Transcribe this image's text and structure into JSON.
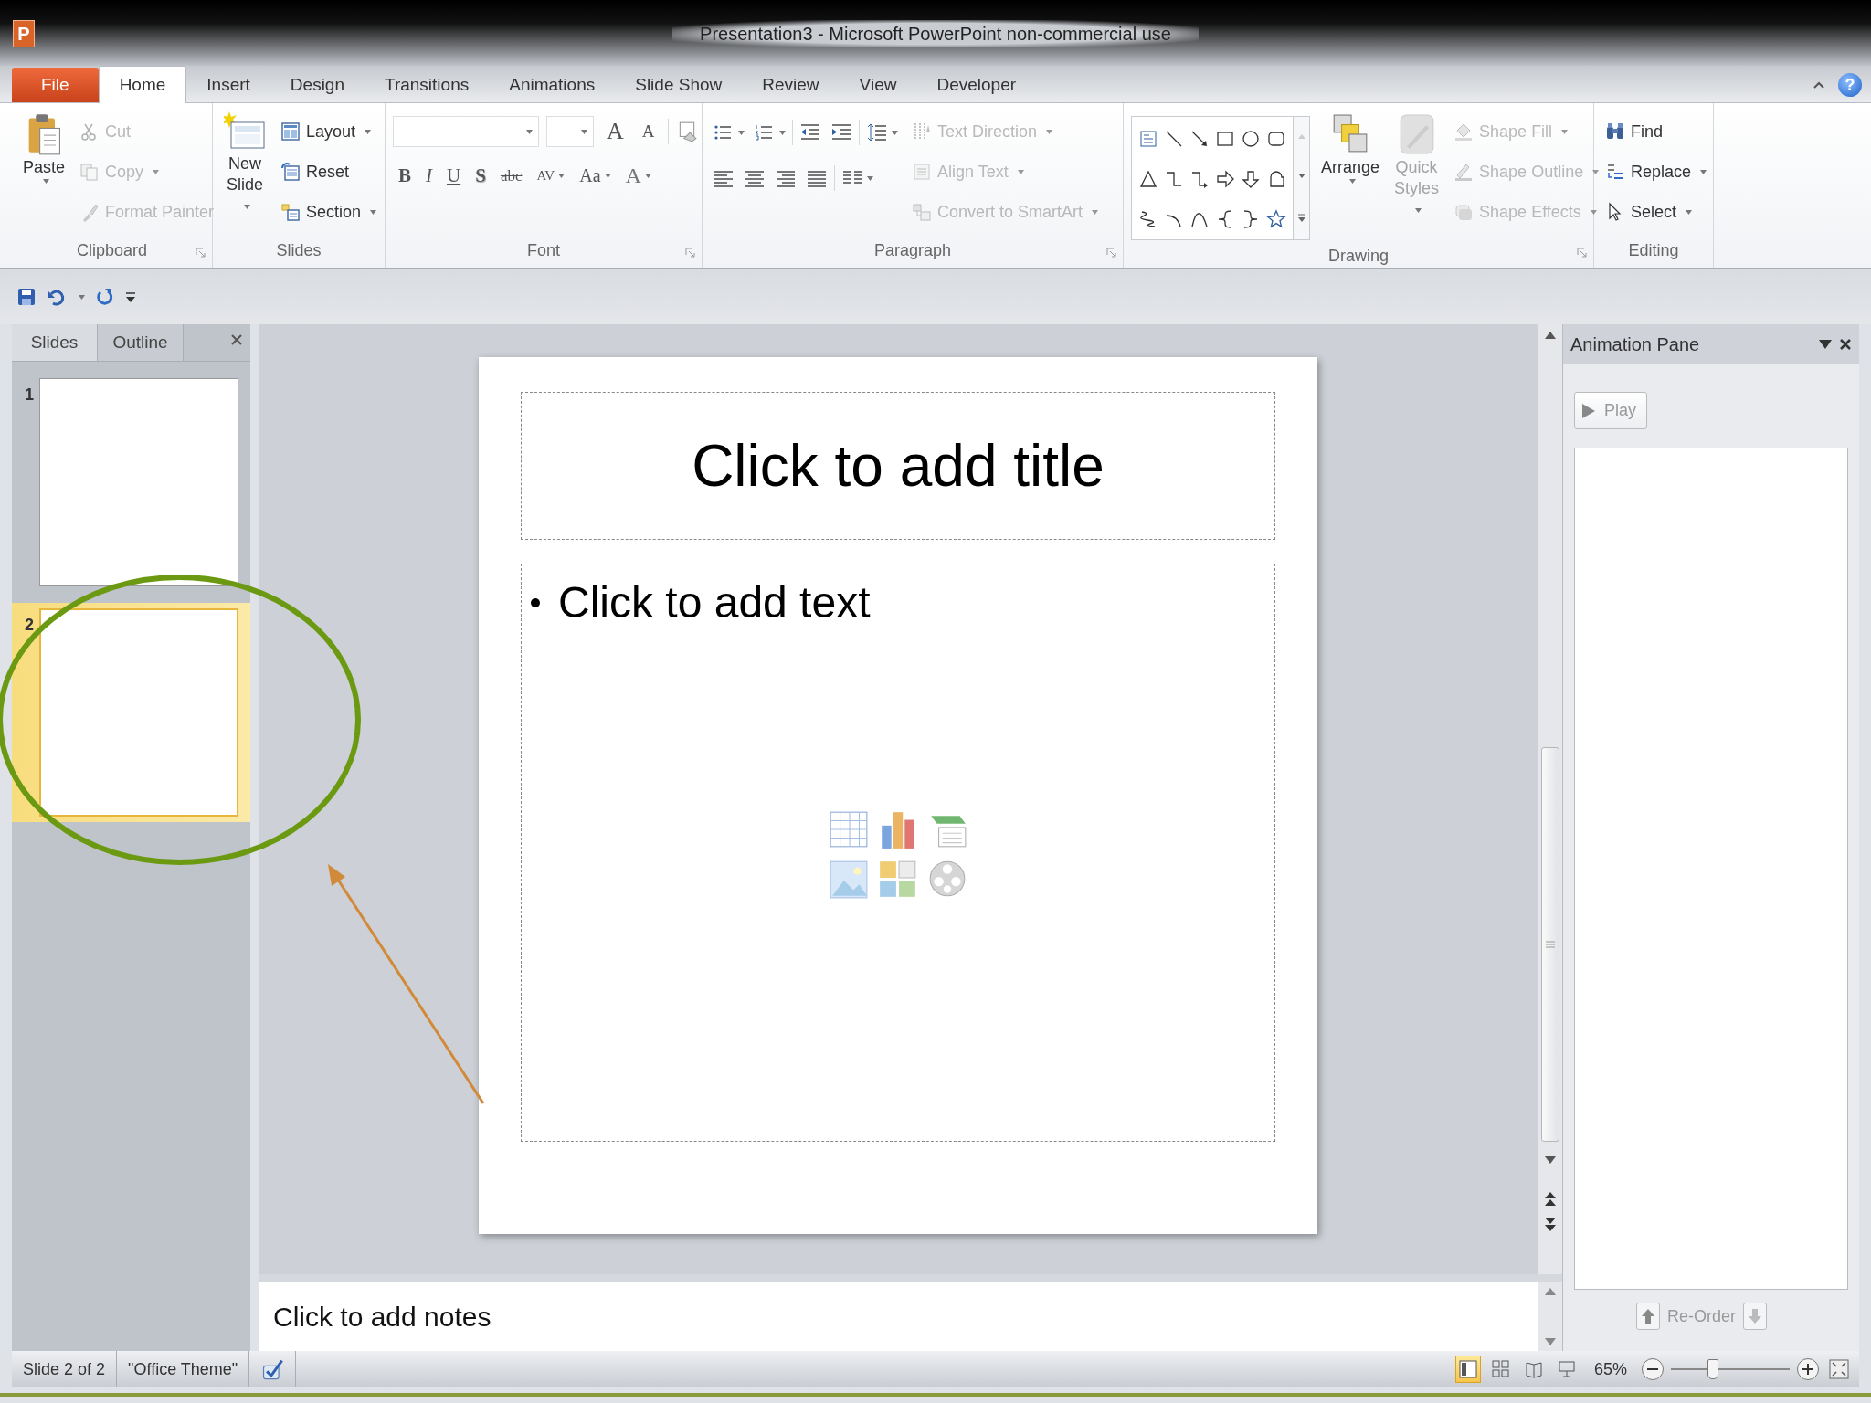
{
  "window": {
    "app_icon": "P",
    "title": "Presentation3 - Microsoft PowerPoint non-commercial use"
  },
  "tabs": [
    {
      "label": "File",
      "kind": "file",
      "selected": false
    },
    {
      "label": "Home",
      "kind": "tab",
      "selected": true
    },
    {
      "label": "Insert",
      "kind": "tab",
      "selected": false
    },
    {
      "label": "Design",
      "kind": "tab",
      "selected": false
    },
    {
      "label": "Transitions",
      "kind": "tab",
      "selected": false
    },
    {
      "label": "Animations",
      "kind": "tab",
      "selected": false
    },
    {
      "label": "Slide Show",
      "kind": "tab",
      "selected": false
    },
    {
      "label": "Review",
      "kind": "tab",
      "selected": false
    },
    {
      "label": "View",
      "kind": "tab",
      "selected": false
    },
    {
      "label": "Developer",
      "kind": "tab",
      "selected": false
    }
  ],
  "help": "?",
  "clipboard": {
    "label": "Clipboard",
    "paste": "Paste",
    "items": [
      {
        "label": "Cut",
        "disabled": true,
        "dropdown": false
      },
      {
        "label": "Copy",
        "disabled": true,
        "dropdown": true
      },
      {
        "label": "Format Painter",
        "disabled": true,
        "dropdown": false
      }
    ]
  },
  "slides_group": {
    "label": "Slides",
    "new_slide": [
      "New",
      "Slide"
    ],
    "items": [
      {
        "label": "Layout",
        "disabled": false,
        "dropdown": true
      },
      {
        "label": "Reset",
        "disabled": false,
        "dropdown": false
      },
      {
        "label": "Section",
        "disabled": false,
        "dropdown": true
      }
    ]
  },
  "font": {
    "label": "Font",
    "size_buttons": [
      {
        "glyph": "A",
        "kind": "grow"
      },
      {
        "glyph": "A",
        "kind": "shrink"
      }
    ],
    "buttons": [
      {
        "glyph": "B",
        "kind": "bold"
      },
      {
        "glyph": "I",
        "kind": "italic"
      },
      {
        "glyph": "U",
        "kind": "underline"
      },
      {
        "glyph": "S",
        "kind": "shadow"
      },
      {
        "glyph": "abc",
        "kind": "strike"
      },
      {
        "glyph": "AV",
        "kind": "spacing"
      },
      {
        "glyph": "Aa",
        "kind": "case"
      },
      {
        "glyph": "A",
        "kind": "color"
      }
    ]
  },
  "paragraph": {
    "label": "Paragraph",
    "items": [
      {
        "label": "Text Direction",
        "disabled": true,
        "dropdown": true
      },
      {
        "label": "Align Text",
        "disabled": true,
        "dropdown": true
      },
      {
        "label": "Convert to SmartArt",
        "disabled": true,
        "dropdown": true
      }
    ]
  },
  "drawing": {
    "label": "Drawing",
    "arrange": "Arrange",
    "quick_styles": {
      "label": [
        "Quick",
        "Styles"
      ],
      "disabled": true
    },
    "items": [
      {
        "label": "Shape Fill",
        "disabled": true,
        "dropdown": true
      },
      {
        "label": "Shape Outline",
        "disabled": true,
        "dropdown": true
      },
      {
        "label": "Shape Effects",
        "disabled": true,
        "dropdown": true
      }
    ]
  },
  "editing": {
    "label": "Editing",
    "items": [
      {
        "label": "Find",
        "disabled": false,
        "dropdown": false
      },
      {
        "label": "Replace",
        "disabled": false,
        "dropdown": true
      },
      {
        "label": "Select",
        "disabled": false,
        "dropdown": true
      }
    ]
  },
  "side_panel": {
    "tabs": [
      {
        "label": "Slides",
        "selected": true
      },
      {
        "label": "Outline",
        "selected": false
      }
    ],
    "thumbnails": [
      {
        "number": "1",
        "selected": false
      },
      {
        "number": "2",
        "selected": true
      }
    ]
  },
  "slide": {
    "title_placeholder": "Click to add title",
    "body_placeholder": "Click to add text"
  },
  "notes": {
    "placeholder": "Click to add notes"
  },
  "animation_pane": {
    "title": "Animation Pane",
    "play": "Play",
    "reorder": "Re-Order"
  },
  "status_bar": {
    "slide": "Slide 2 of 2",
    "theme": "\"Office Theme\"",
    "views": [
      {
        "selected": true
      },
      {
        "selected": false
      },
      {
        "selected": false
      },
      {
        "selected": false
      }
    ],
    "zoom": "65%",
    "zoom_slider": {
      "level": 0.35
    }
  }
}
